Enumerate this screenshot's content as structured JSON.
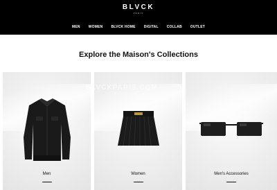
{
  "header": {
    "brand": "BLVCK",
    "brand_sub": "PARIS",
    "nav": [
      "MEN",
      "WOMEN",
      "BLVCK HOME",
      "DIGITAL",
      "COLLAB",
      "OUTLET"
    ]
  },
  "main": {
    "heading": "Explore the Maison's Collections",
    "collections": [
      {
        "label": "Men",
        "image": "black-bomber-jacket"
      },
      {
        "label": "Women",
        "image": "black-pleated-skirt"
      },
      {
        "label": "Men's Accessories",
        "image": "black-sunglasses"
      }
    ]
  },
  "watermark": "BLVCKPARIS.COM",
  "colors": {
    "header_bg": "#000000",
    "header_text": "#ffffff",
    "card_bg": "#ececec",
    "text": "#111111"
  }
}
